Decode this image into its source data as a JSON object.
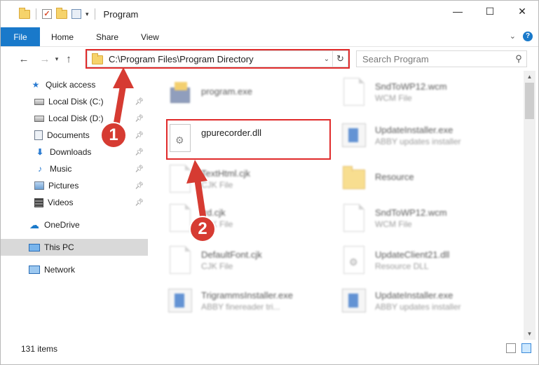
{
  "window": {
    "title": "Program",
    "controls": {
      "minimize": "—",
      "maximize": "☐",
      "close": "✕"
    }
  },
  "ribbon": {
    "tabs": [
      "File",
      "Home",
      "Share",
      "View"
    ],
    "expand_label": "⌄",
    "help_label": "?"
  },
  "nav": {
    "address": "C:\\Program Files\\Program Directory",
    "search_placeholder": "Search Program"
  },
  "sidebar": {
    "items": [
      {
        "label": "Quick access",
        "icon": "star-icon"
      },
      {
        "label": "Local Disk (C:)",
        "icon": "drive-icon",
        "pinned": true
      },
      {
        "label": "Local Disk (D:)",
        "icon": "drive-icon",
        "pinned": true
      },
      {
        "label": "Documents",
        "icon": "documents-icon",
        "pinned": true
      },
      {
        "label": "Downloads",
        "icon": "download-icon",
        "pinned": true
      },
      {
        "label": "Music",
        "icon": "music-icon",
        "pinned": true
      },
      {
        "label": "Pictures",
        "icon": "pictures-icon",
        "pinned": true
      },
      {
        "label": "Videos",
        "icon": "videos-icon",
        "pinned": true
      },
      {
        "label": "OneDrive",
        "icon": "cloud-icon"
      },
      {
        "label": "This PC",
        "icon": "computer-icon",
        "selected": true
      },
      {
        "label": "Network",
        "icon": "network-icon"
      }
    ]
  },
  "files": {
    "left": [
      {
        "name": "program.exe",
        "type": ""
      },
      {
        "name": "gpurecorder.dll",
        "type": ""
      },
      {
        "name": "TextHtml.cjk",
        "type": "CJK File"
      },
      {
        "name": "Ird.cjk",
        "type": "CJK File"
      },
      {
        "name": "DefaultFont.cjk",
        "type": "CJK File"
      },
      {
        "name": "TrigrammsInstaller.exe",
        "type": "ABBY finereader tri..."
      }
    ],
    "right": [
      {
        "name": "SndToWP12.wcm",
        "type": "WCM File"
      },
      {
        "name": "UpdateInstaller.exe",
        "type": "ABBY updates installer"
      },
      {
        "name": "Resource",
        "type": ""
      },
      {
        "name": "SndToWP12.wcm",
        "type": "WCM File"
      },
      {
        "name": "UpdateClient21.dll",
        "type": "Resource DLL"
      },
      {
        "name": "UpdateInstaller.exe",
        "type": "ABBY updates installer"
      }
    ]
  },
  "status": {
    "item_count": "131 items"
  },
  "markers": {
    "one": "1",
    "two": "2"
  },
  "colors": {
    "accent": "#1979ca",
    "highlight": "#e02a2a",
    "marker": "#d63b32"
  }
}
